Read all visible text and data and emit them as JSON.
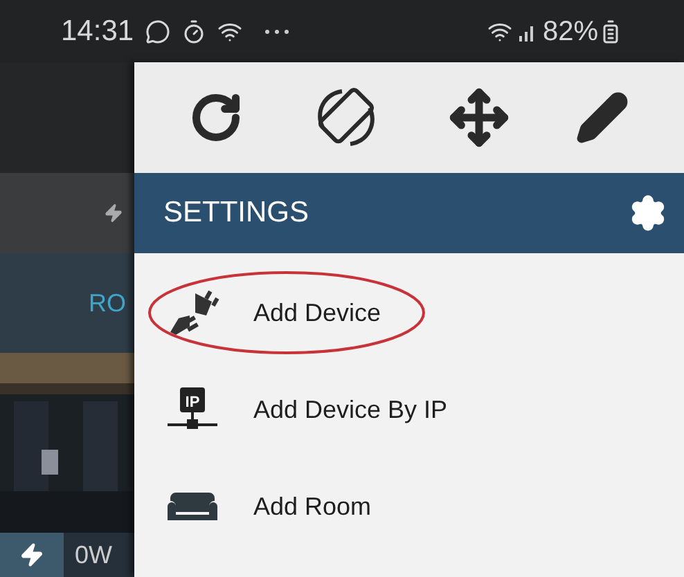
{
  "status_bar": {
    "time": "14:31",
    "battery": "82%"
  },
  "background": {
    "tab": "RO",
    "power": "0W"
  },
  "menu": {
    "title": "SETTINGS",
    "items": [
      {
        "kind": "plug",
        "label": "Add Device",
        "highlighted": true
      },
      {
        "kind": "ip",
        "icon_text": "IP",
        "label": "Add Device By IP",
        "highlighted": false
      },
      {
        "kind": "sofa",
        "label": "Add Room",
        "highlighted": false
      }
    ]
  }
}
